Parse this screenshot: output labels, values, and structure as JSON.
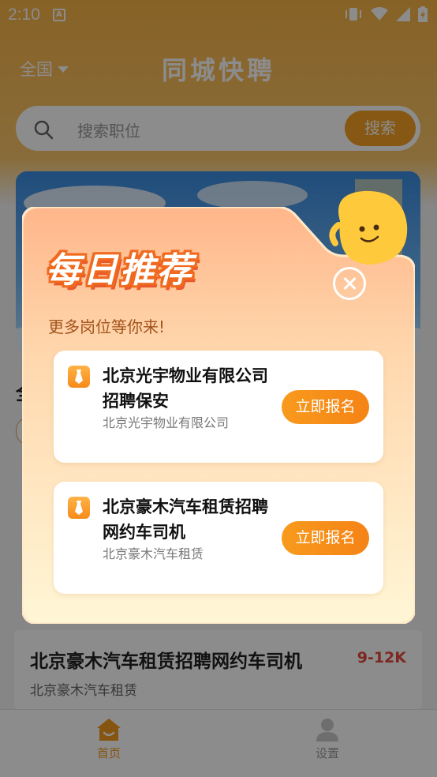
{
  "status_bar": {
    "time": "2:10"
  },
  "header": {
    "region": "全国",
    "title": "同城快聘"
  },
  "search": {
    "placeholder": "搜索职位",
    "button_label": "搜索"
  },
  "background_job": {
    "title": "北京豪木汽车租赁招聘网约车司机",
    "salary": "9-12K",
    "company": "北京豪木汽车租赁"
  },
  "tabbar": {
    "items": [
      {
        "label": "首页",
        "icon": "home-icon",
        "active": true
      },
      {
        "label": "设置",
        "icon": "person-icon",
        "active": false
      }
    ]
  },
  "popup": {
    "title": "每日推荐",
    "subtitle": "更多岗位等你来!",
    "close_icon": "close-icon",
    "recommendations": [
      {
        "title": "北京光宇物业有限公司招聘保安",
        "company": "北京光宇物业有限公司",
        "button": "立即报名"
      },
      {
        "title": "北京豪木汽车租赁招聘网约车司机",
        "company": "北京豪木汽车租赁",
        "button": "立即报名"
      }
    ]
  },
  "colors": {
    "accent_orange": "#F58316",
    "header_orange": "#F6B347",
    "salary_red": "#E24A3B",
    "popup_gradient_top": "#FFB68A",
    "popup_gradient_bottom": "#FFF6D6"
  }
}
